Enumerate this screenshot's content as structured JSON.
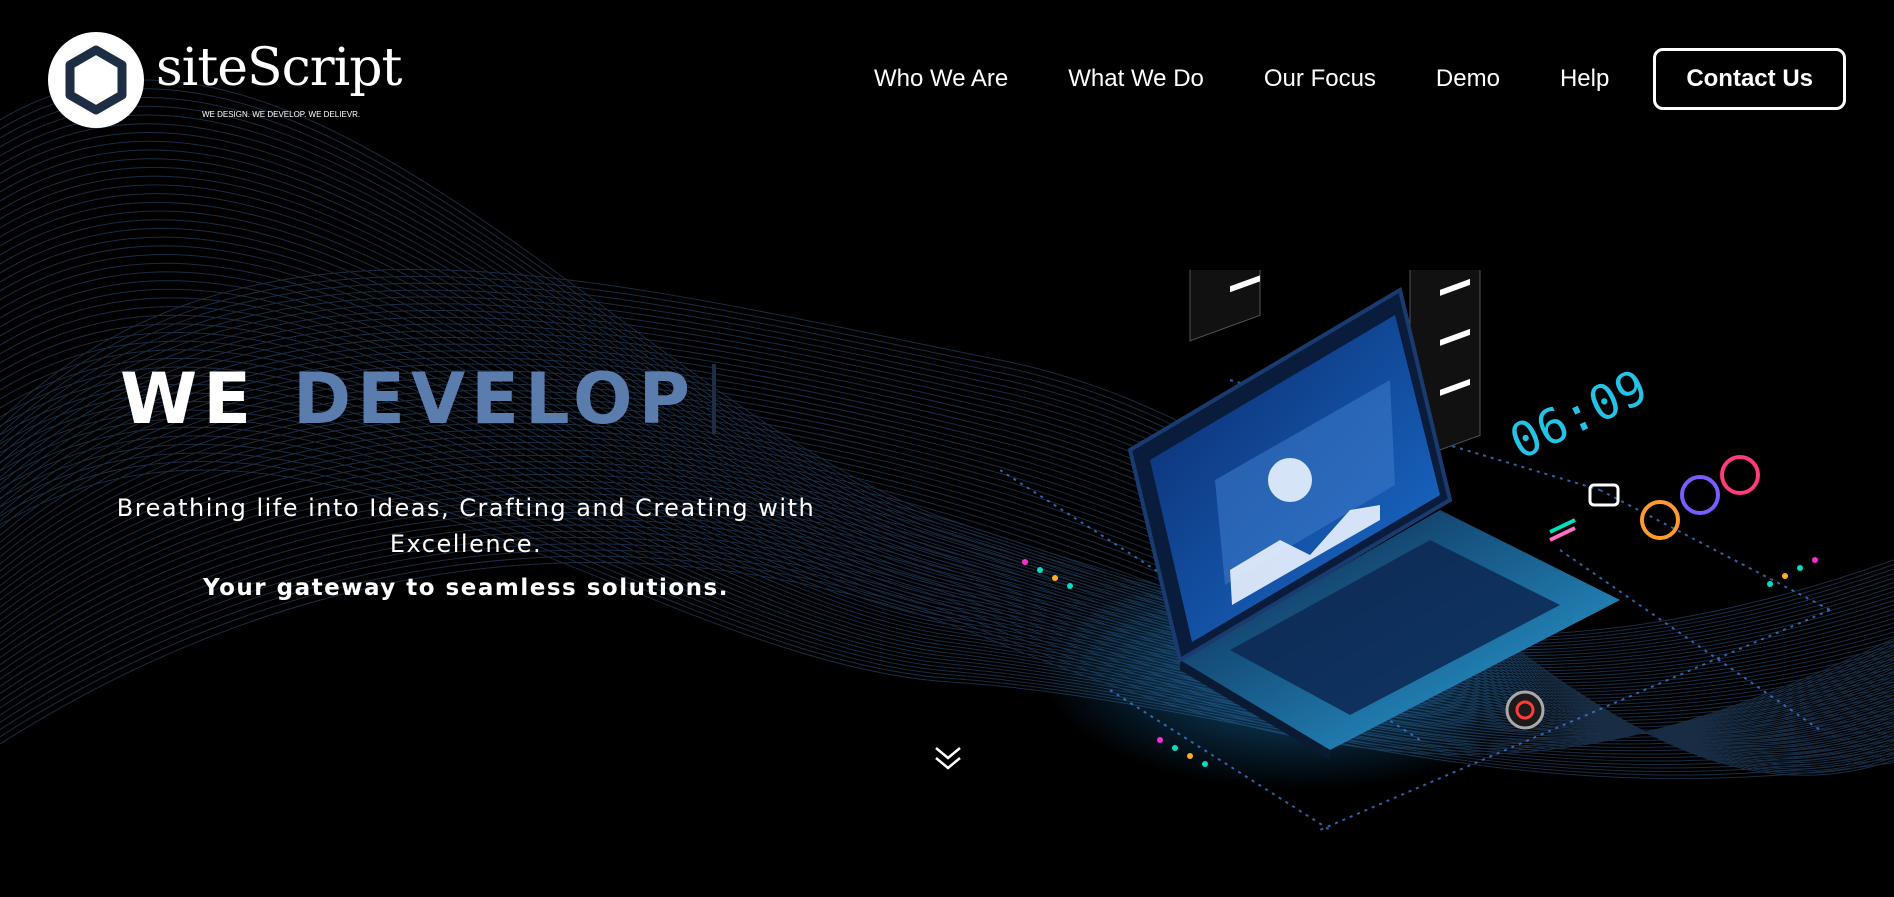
{
  "brand": {
    "name": "siteScript",
    "tagline": "WE DESIGN. WE DEVELOP. WE DELIEVR.",
    "logo_icon": "hexagon-swirl-icon"
  },
  "nav": {
    "items": [
      {
        "label": "Who We Are"
      },
      {
        "label": "What We Do"
      },
      {
        "label": "Our Focus"
      },
      {
        "label": "Demo"
      },
      {
        "label": "Help"
      }
    ],
    "cta_label": "Contact Us"
  },
  "hero": {
    "heading_static": "WE",
    "heading_dynamic": "DEVELOP",
    "subtitle": "Breathing life into Ideas, Crafting and Creating with Excellence.",
    "tagline": "Your gateway to seamless solutions.",
    "scroll_icon": "double-chevron-down-icon"
  },
  "illustration": {
    "clock": "06:09",
    "icon_name": "isometric-laptop-illustration"
  },
  "colors": {
    "background": "#000000",
    "accent": "#5b7dae",
    "text": "#ffffff",
    "laptop_blue": "#1b6fd1",
    "clock_cyan": "#22c3e6"
  }
}
